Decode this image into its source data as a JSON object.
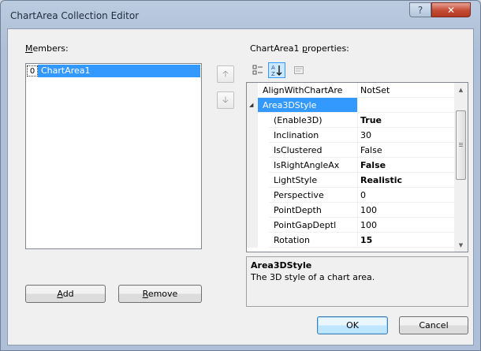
{
  "window": {
    "title": "ChartArea Collection Editor",
    "help_glyph": "?",
    "close_glyph": "✕"
  },
  "members": {
    "label_mnemonic": "M",
    "label_rest": "embers:",
    "items": [
      {
        "index": "0",
        "label": "ChartArea1"
      }
    ],
    "move_up_glyph": "🡡",
    "move_down_glyph": "🡣",
    "add_mnemonic": "A",
    "add_rest": "dd",
    "remove_mnemonic": "R",
    "remove_rest": "emove"
  },
  "properties": {
    "label_start": "ChartArea1 ",
    "label_mnemonic": "p",
    "label_rest": "roperties:",
    "toolbar_icons": [
      "categorized-icon",
      "alphabetical-icon",
      "property-pages-icon"
    ],
    "rows": [
      {
        "name": "AlignWithChartAre",
        "value": "NotSet",
        "bold": false,
        "indent": false,
        "selected": false,
        "expander": ""
      },
      {
        "name": "Area3DStyle",
        "value": "",
        "bold": false,
        "indent": false,
        "selected": true,
        "expander": "◢"
      },
      {
        "name": "(Enable3D)",
        "value": "True",
        "bold": true,
        "indent": true,
        "selected": false,
        "expander": ""
      },
      {
        "name": "Inclination",
        "value": "30",
        "bold": false,
        "indent": true,
        "selected": false,
        "expander": ""
      },
      {
        "name": "IsClustered",
        "value": "False",
        "bold": false,
        "indent": true,
        "selected": false,
        "expander": ""
      },
      {
        "name": "IsRightAngleAx",
        "value": "False",
        "bold": true,
        "indent": true,
        "selected": false,
        "expander": ""
      },
      {
        "name": "LightStyle",
        "value": "Realistic",
        "bold": true,
        "indent": true,
        "selected": false,
        "expander": ""
      },
      {
        "name": "Perspective",
        "value": "0",
        "bold": false,
        "indent": true,
        "selected": false,
        "expander": ""
      },
      {
        "name": "PointDepth",
        "value": "100",
        "bold": false,
        "indent": true,
        "selected": false,
        "expander": ""
      },
      {
        "name": "PointGapDeptl",
        "value": "100",
        "bold": false,
        "indent": true,
        "selected": false,
        "expander": ""
      },
      {
        "name": "Rotation",
        "value": "15",
        "bold": true,
        "indent": true,
        "selected": false,
        "expander": ""
      }
    ],
    "description": {
      "title": "Area3DStyle",
      "text": "The 3D style of a chart area."
    }
  },
  "buttons": {
    "ok": "OK",
    "cancel": "Cancel"
  },
  "colors": {
    "selection": "#3399ff",
    "close": "#c44a34"
  }
}
